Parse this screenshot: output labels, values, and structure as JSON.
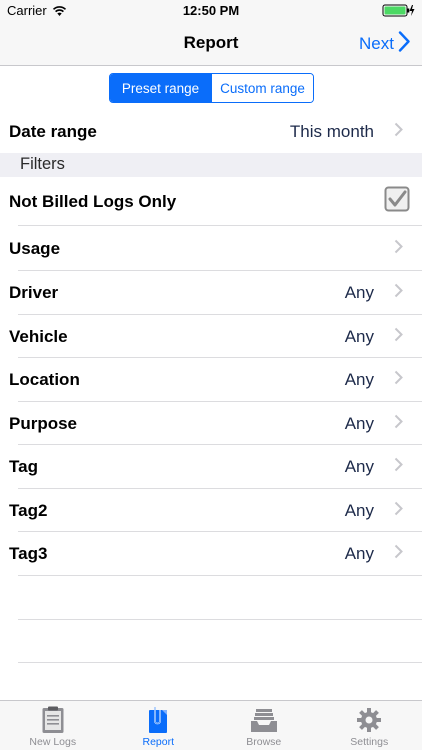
{
  "status": {
    "carrier": "Carrier",
    "time": "12:50 PM",
    "battery_color": "#4cd964"
  },
  "nav": {
    "title": "Report",
    "next_label": "Next"
  },
  "range_segments": [
    {
      "label": "Preset range",
      "selected": true
    },
    {
      "label": "Custom range",
      "selected": false
    }
  ],
  "date_range": {
    "label": "Date range",
    "value": "This month"
  },
  "filters_header": "Filters",
  "not_billed": {
    "label": "Not Billed Logs Only",
    "checked": true
  },
  "rows": [
    {
      "label": "Usage",
      "value": ""
    },
    {
      "label": "Driver",
      "value": "Any"
    },
    {
      "label": "Vehicle",
      "value": "Any"
    },
    {
      "label": "Location",
      "value": "Any"
    },
    {
      "label": "Purpose",
      "value": "Any"
    },
    {
      "label": "Tag",
      "value": "Any"
    },
    {
      "label": "Tag2",
      "value": "Any"
    },
    {
      "label": "Tag3",
      "value": "Any"
    }
  ],
  "tabs": [
    {
      "label": "New Logs",
      "icon": "clipboard-icon",
      "active": false
    },
    {
      "label": "Report",
      "icon": "report-icon",
      "active": true
    },
    {
      "label": "Browse",
      "icon": "inbox-tray-icon",
      "active": false
    },
    {
      "label": "Settings",
      "icon": "gear-icon",
      "active": false
    }
  ],
  "colors": {
    "accent": "#0a6dfa",
    "value_text": "#1d2a4a",
    "inactive": "#8e8e93"
  }
}
